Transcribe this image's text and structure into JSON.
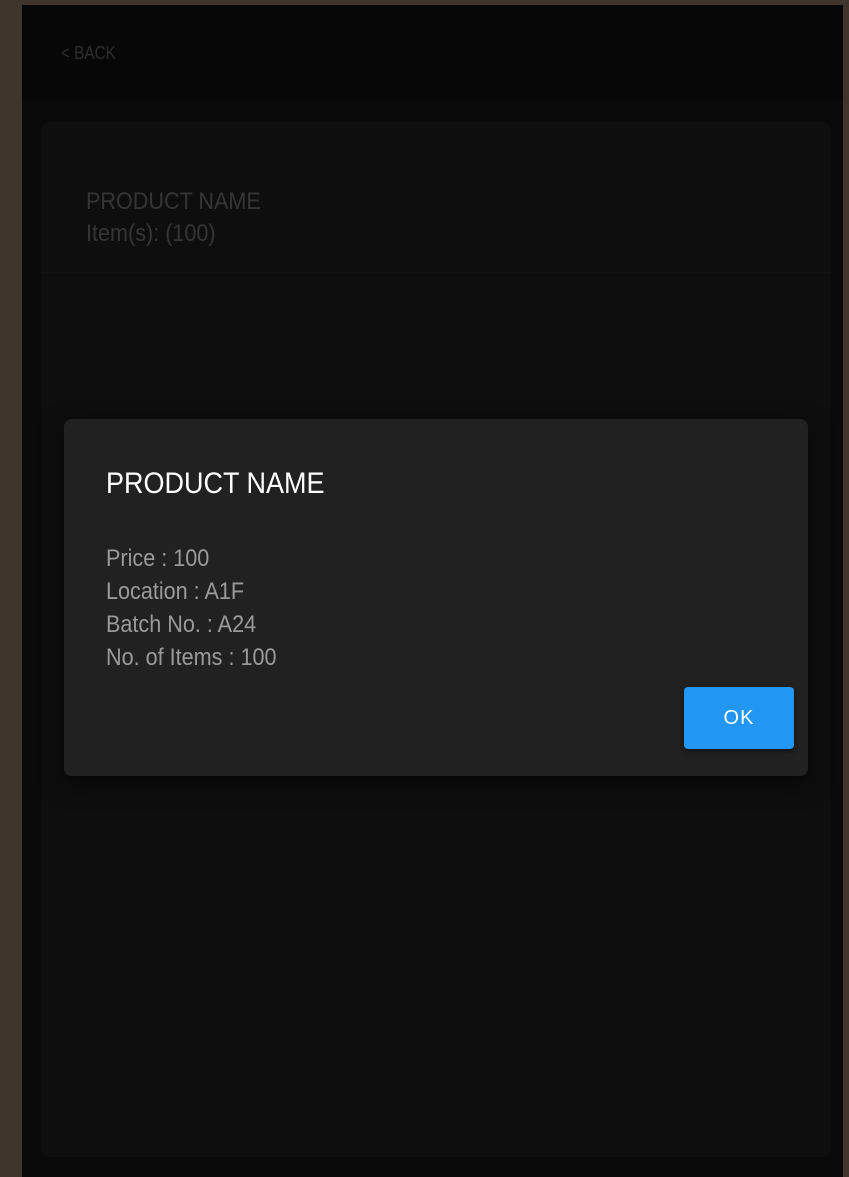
{
  "nav": {
    "back_label": "< BACK"
  },
  "list": {
    "items": [
      {
        "title": "PRODUCT NAME",
        "subtitle": "Item(s): (100)"
      }
    ]
  },
  "dialog": {
    "title": "PRODUCT NAME",
    "details": [
      "Price : 100",
      "Location : A1F",
      "Batch No. : A24",
      "No. of Items : 100"
    ],
    "ok_label": "OK"
  },
  "colors": {
    "accent": "#2196f3",
    "background": "#141414",
    "dialog_background": "#212121"
  }
}
